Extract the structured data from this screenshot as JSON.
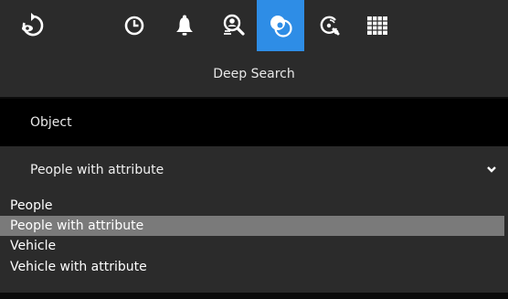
{
  "toolbar": {
    "items": [
      {
        "icon": "back-eye-icon"
      },
      {
        "icon": "clock-icon"
      },
      {
        "icon": "bell-icon"
      },
      {
        "icon": "search-person-icon"
      },
      {
        "icon": "deep-search-icon",
        "active": true
      },
      {
        "icon": "speed-search-icon"
      },
      {
        "icon": "grid-layout-icon"
      }
    ],
    "active_color": "#2e8de6"
  },
  "header": {
    "title": "Deep Search"
  },
  "section": {
    "label": "Object"
  },
  "object_select": {
    "selected": "People with attribute",
    "options": [
      "People",
      "People with attribute",
      "Vehicle",
      "Vehicle with attribute"
    ]
  }
}
